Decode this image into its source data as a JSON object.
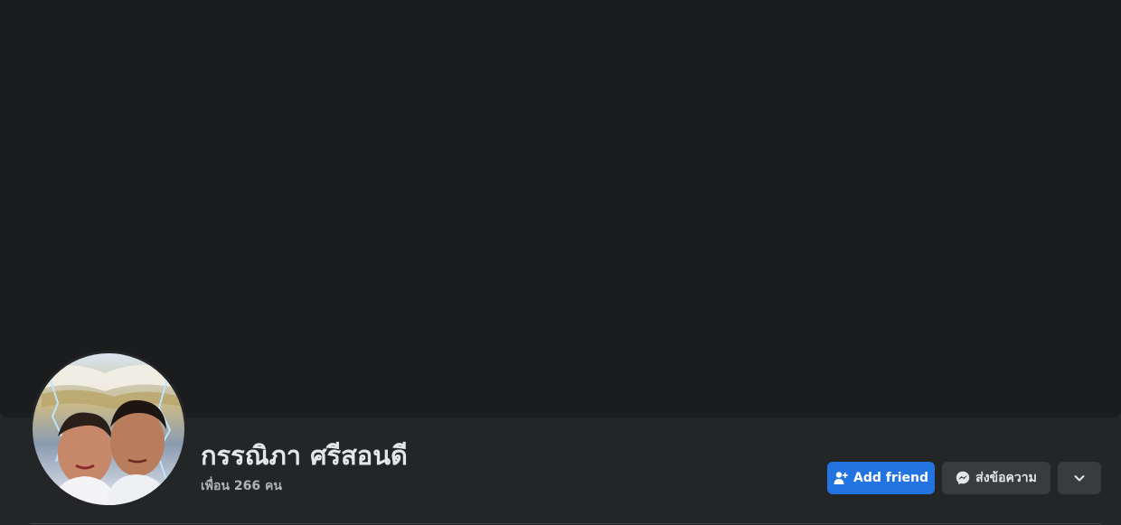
{
  "profile": {
    "name": "กรรณิภา ศรีสอนดี",
    "friends_text": "เพื่อน 266 คน"
  },
  "actions": {
    "add_friend_label": "Add friend",
    "message_label": "ส่งข้อความ",
    "add_friend_icon": "person-add-icon",
    "message_icon": "messenger-icon",
    "more_icon": "chevron-down-icon"
  },
  "colors": {
    "primary_button": "#2374e1",
    "secondary_button": "#3a3b3c",
    "cover": "#1b1c1e",
    "background": "#242526"
  }
}
